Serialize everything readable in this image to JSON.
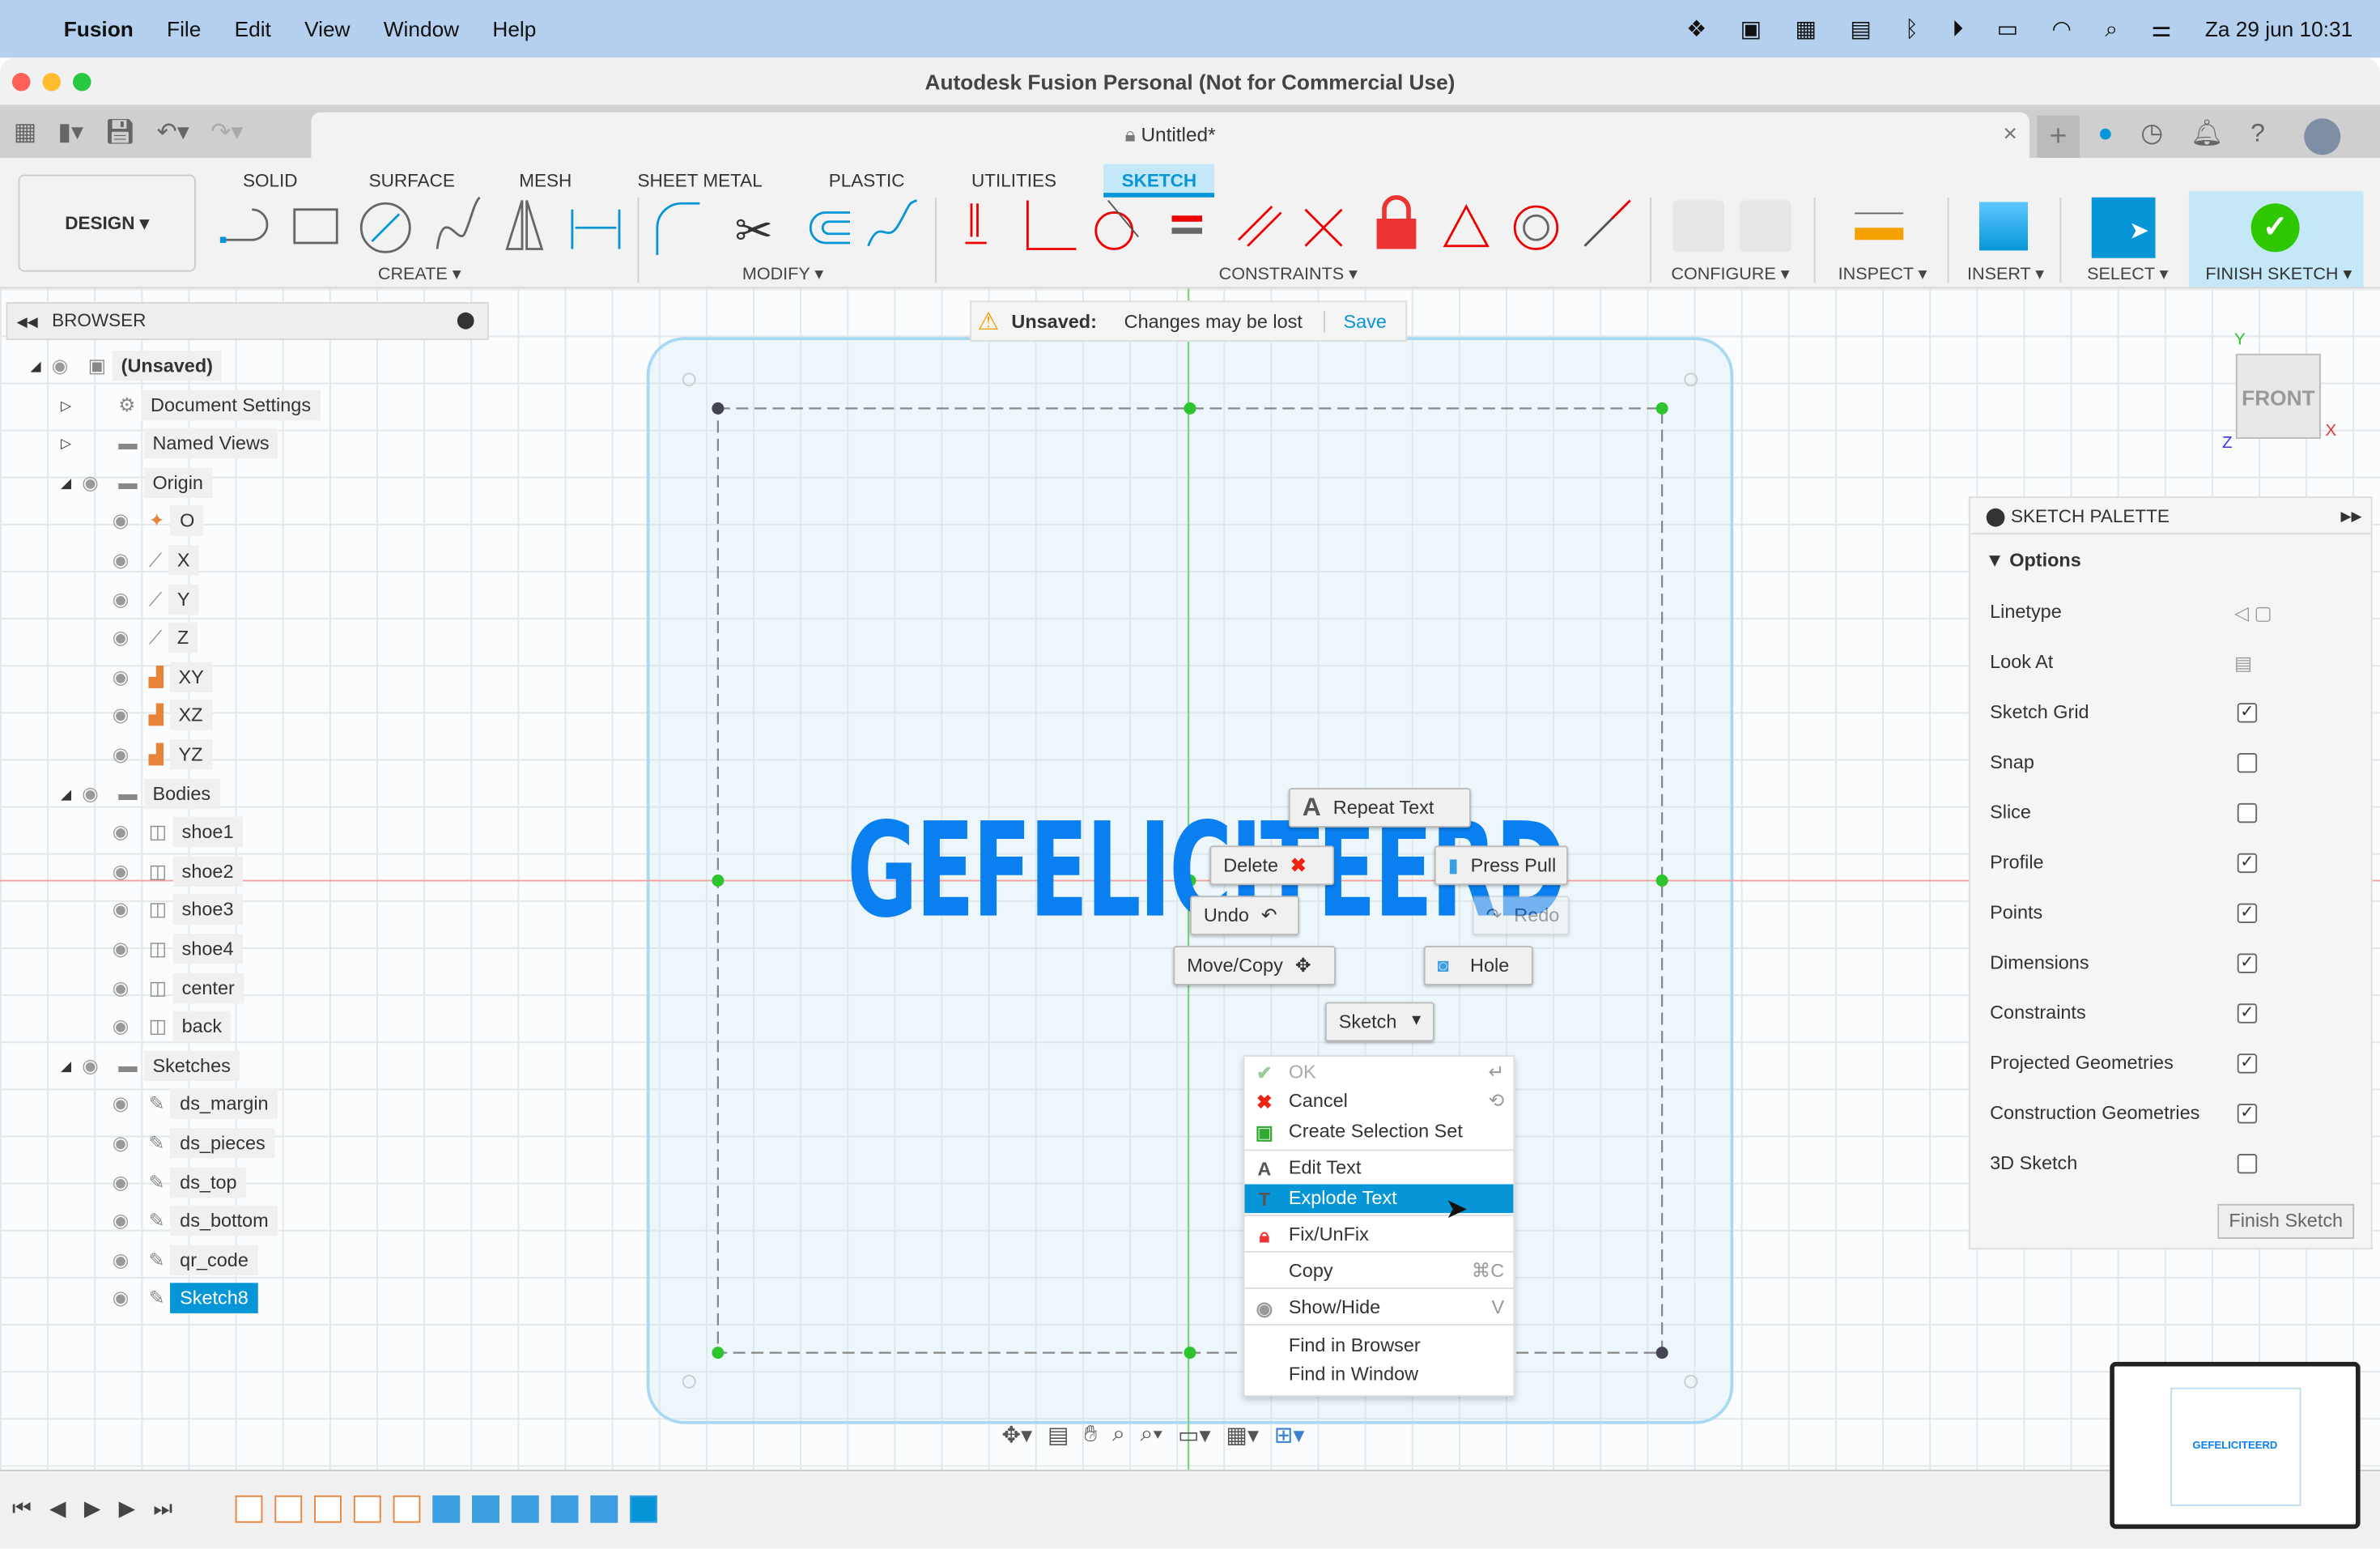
{
  "menubar": {
    "app": "Fusion",
    "items": [
      "File",
      "Edit",
      "View",
      "Window",
      "Help"
    ],
    "clock": "Za 29 jun  10:31"
  },
  "window": {
    "title": "Autodesk Fusion Personal (Not for Commercial Use)"
  },
  "document": {
    "tab_title": "Untitled*"
  },
  "ribbon": {
    "workspace": "DESIGN ▾",
    "tabs": [
      "SOLID",
      "SURFACE",
      "MESH",
      "SHEET METAL",
      "PLASTIC",
      "UTILITIES",
      "SKETCH"
    ],
    "active_tab": "SKETCH",
    "groups": {
      "create": "CREATE ▾",
      "modify": "MODIFY ▾",
      "constraints": "CONSTRAINTS ▾",
      "configure": "CONFIGURE ▾",
      "inspect": "INSPECT ▾",
      "insert": "INSERT ▾",
      "select": "SELECT ▾",
      "finish": "FINISH SKETCH ▾"
    }
  },
  "unsaved_bar": {
    "label": "Unsaved:",
    "message": "Changes may be lost",
    "save": "Save"
  },
  "browser": {
    "title": "BROWSER",
    "items": [
      {
        "label": "(Unsaved)",
        "level": 0,
        "icon": "component-icon",
        "expanded": true
      },
      {
        "label": "Document Settings",
        "level": 1,
        "icon": "gear-icon"
      },
      {
        "label": "Named Views",
        "level": 1,
        "icon": "folder-icon"
      },
      {
        "label": "Origin",
        "level": 1,
        "icon": "folder-icon",
        "expanded": true
      },
      {
        "label": "O",
        "level": 2,
        "icon": "origin-point-icon"
      },
      {
        "label": "X",
        "level": 2,
        "icon": "axis-icon"
      },
      {
        "label": "Y",
        "level": 2,
        "icon": "axis-icon"
      },
      {
        "label": "Z",
        "level": 2,
        "icon": "axis-icon"
      },
      {
        "label": "XY",
        "level": 2,
        "icon": "plane-icon"
      },
      {
        "label": "XZ",
        "level": 2,
        "icon": "plane-icon"
      },
      {
        "label": "YZ",
        "level": 2,
        "icon": "plane-icon"
      },
      {
        "label": "Bodies",
        "level": 1,
        "icon": "folder-icon",
        "expanded": true
      },
      {
        "label": "shoe1",
        "level": 2,
        "icon": "body-icon"
      },
      {
        "label": "shoe2",
        "level": 2,
        "icon": "body-icon"
      },
      {
        "label": "shoe3",
        "level": 2,
        "icon": "body-icon"
      },
      {
        "label": "shoe4",
        "level": 2,
        "icon": "body-icon"
      },
      {
        "label": "center",
        "level": 2,
        "icon": "body-icon"
      },
      {
        "label": "back",
        "level": 2,
        "icon": "body-icon"
      },
      {
        "label": "Sketches",
        "level": 1,
        "icon": "folder-icon",
        "expanded": true
      },
      {
        "label": "ds_margin",
        "level": 2,
        "icon": "sketch-icon"
      },
      {
        "label": "ds_pieces",
        "level": 2,
        "icon": "sketch-icon"
      },
      {
        "label": "ds_top",
        "level": 2,
        "icon": "sketch-icon"
      },
      {
        "label": "ds_bottom",
        "level": 2,
        "icon": "sketch-icon"
      },
      {
        "label": "qr_code",
        "level": 2,
        "icon": "sketch-icon"
      },
      {
        "label": "Sketch8",
        "level": 2,
        "icon": "sketch-icon",
        "selected": true
      }
    ]
  },
  "sketch_text": "GEFELICITEERD",
  "marking_menu": {
    "repeat": "Repeat Text",
    "delete": "Delete",
    "press_pull": "Press Pull",
    "undo": "Undo",
    "redo": "Redo",
    "move_copy": "Move/Copy",
    "hole": "Hole",
    "sketch": "Sketch"
  },
  "context_menu": {
    "items": [
      {
        "label": "OK",
        "shortcut": "↵",
        "disabled": true
      },
      {
        "label": "Cancel",
        "shortcut": "⟲"
      },
      {
        "label": "Create Selection Set"
      },
      {
        "label": "Edit Text"
      },
      {
        "label": "Explode Text",
        "highlighted": true
      },
      {
        "label": "Fix/UnFix"
      },
      {
        "label": "Copy",
        "shortcut": "⌘C"
      },
      {
        "label": "Show/Hide",
        "shortcut": "V"
      },
      {
        "label": "Find in Browser"
      },
      {
        "label": "Find in Window"
      }
    ]
  },
  "viewcube": {
    "face": "FRONT",
    "x": "X",
    "y": "Y",
    "z": "Z"
  },
  "palette": {
    "title": "SKETCH PALETTE",
    "section": "Options",
    "rows": [
      {
        "label": "Linetype"
      },
      {
        "label": "Look At"
      },
      {
        "label": "Sketch Grid",
        "checked": true
      },
      {
        "label": "Snap",
        "checked": false
      },
      {
        "label": "Slice",
        "checked": false
      },
      {
        "label": "Profile",
        "checked": true
      },
      {
        "label": "Points",
        "checked": true
      },
      {
        "label": "Dimensions",
        "checked": true
      },
      {
        "label": "Constraints",
        "checked": true
      },
      {
        "label": "Projected Geometries",
        "checked": true
      },
      {
        "label": "Construction Geometries",
        "checked": true
      },
      {
        "label": "3D Sketch",
        "checked": false
      }
    ],
    "finish": "Finish Sketch"
  },
  "minimap_text": "GEFELICITEERD",
  "colors": {
    "accent": "#0696d7",
    "text_blue": "#0a7ff0",
    "menubar": "#b5d0ee",
    "finish_green": "#2ec700"
  }
}
